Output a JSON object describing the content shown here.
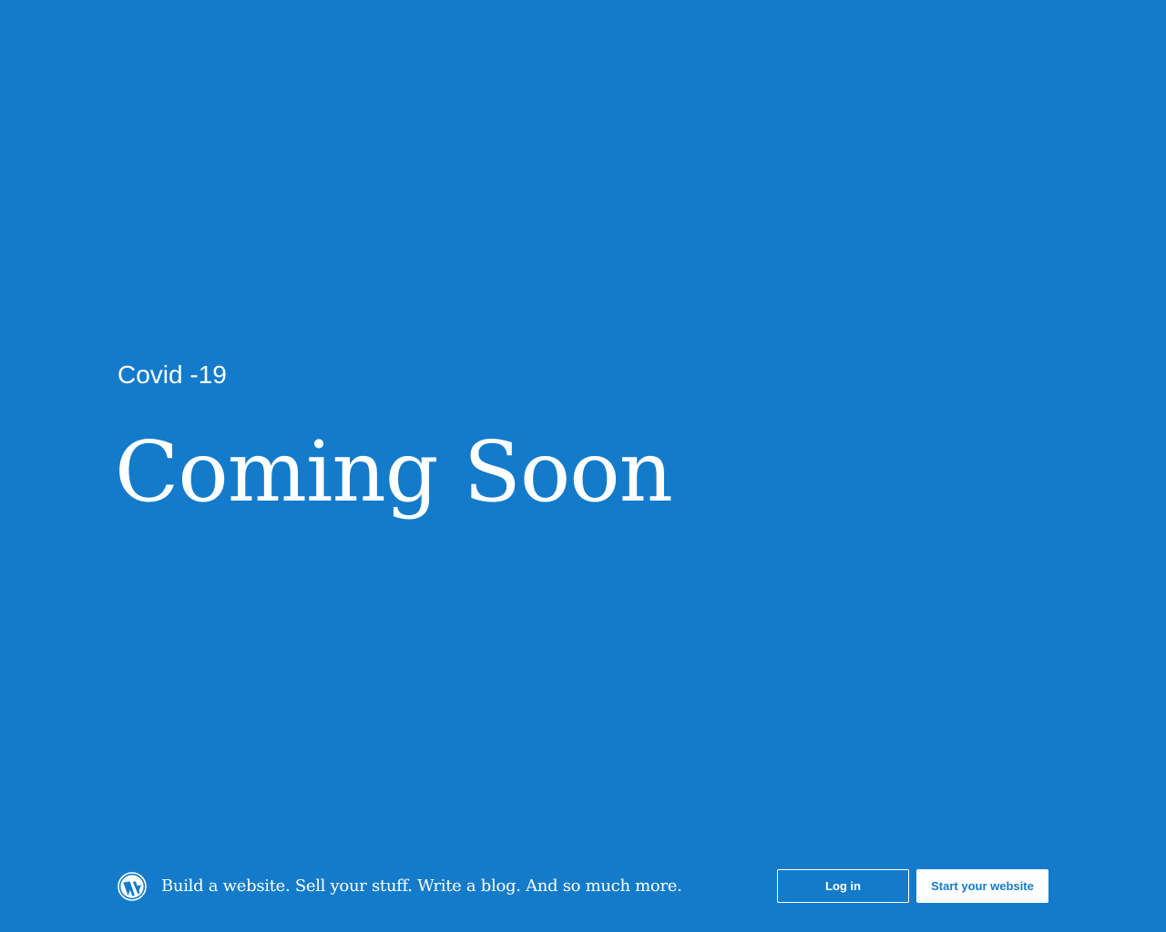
{
  "site": {
    "title": "Covid -19",
    "headline": "Coming Soon"
  },
  "footer": {
    "logo_icon": "wordpress-logo-icon",
    "tagline": "Build a website. Sell your stuff. Write a blog. And so much more.",
    "login_label": "Log in",
    "start_label": "Start your website"
  },
  "colors": {
    "background": "#137BCA",
    "text": "#FFFFFF"
  }
}
